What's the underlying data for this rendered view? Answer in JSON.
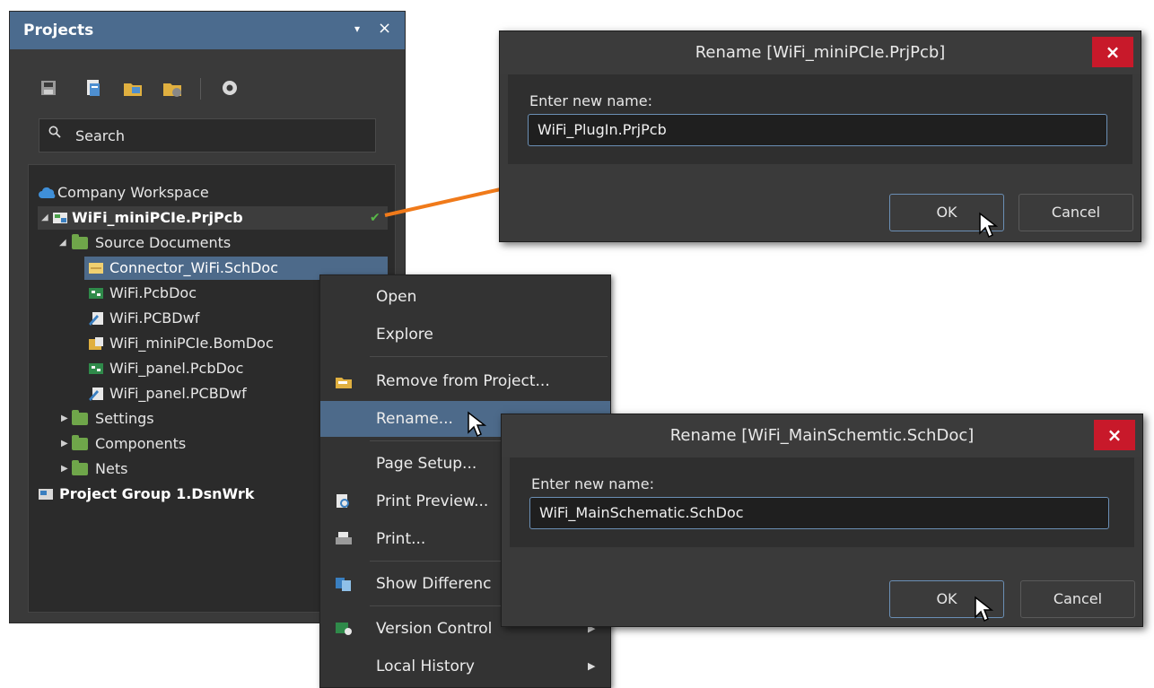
{
  "projects_panel": {
    "title": "Projects",
    "pin_icon": "▾",
    "close_icon": "×",
    "toolbar_icons": [
      "save-icon",
      "project-options-icon",
      "add-folder-icon",
      "remove-folder-icon",
      "settings-icon"
    ],
    "search": {
      "placeholder": "Search"
    },
    "tree": [
      {
        "label": "Company Workspace",
        "icon": "cloud-icon"
      },
      {
        "label": "WiFi_miniPCIe.PrjPcb",
        "icon": "pcb-project-icon",
        "status": "✔"
      },
      {
        "label": "Source Documents",
        "icon": "folder-icon"
      },
      {
        "label": "Connector_WiFi.SchDoc",
        "icon": "schematic-doc-icon"
      },
      {
        "label": "WiFi.PcbDoc",
        "icon": "pcb-doc-icon"
      },
      {
        "label": "WiFi.PCBDwf",
        "icon": "pcb-draftsman-icon"
      },
      {
        "label": "WiFi_miniPCIe.BomDoc",
        "icon": "bom-doc-icon"
      },
      {
        "label": "WiFi_panel.PcbDoc",
        "icon": "pcb-doc-icon"
      },
      {
        "label": "WiFi_panel.PCBDwf",
        "icon": "pcb-draftsman-icon"
      },
      {
        "label": "Settings",
        "icon": "folder-icon"
      },
      {
        "label": "Components",
        "icon": "folder-icon"
      },
      {
        "label": "Nets",
        "icon": "folder-icon"
      },
      {
        "label": "Project Group 1.DsnWrk",
        "icon": "project-group-icon"
      }
    ]
  },
  "context_menu": {
    "items": [
      {
        "label": "Open"
      },
      {
        "label": "Explore"
      },
      {
        "label": "Remove from Project..."
      },
      {
        "label": "Rename..."
      },
      {
        "label": "Page Setup..."
      },
      {
        "label": "Print Preview..."
      },
      {
        "label": "Print..."
      },
      {
        "label": "Show Differenc"
      },
      {
        "label": "Version Control"
      },
      {
        "label": "Local History"
      }
    ]
  },
  "dialog_project": {
    "title": "Rename [WiFi_miniPCIe.PrjPcb]",
    "prompt": "Enter new name:",
    "value": "WiFi_PlugIn.PrjPcb",
    "ok": "OK",
    "cancel": "Cancel",
    "close_icon": "×"
  },
  "dialog_doc": {
    "title": "Rename [WiFi_MainSchemtic.SchDoc]",
    "prompt": "Enter new name:",
    "value": "WiFi_MainSchematic.SchDoc",
    "ok": "OK",
    "cancel": "Cancel",
    "close_icon": "×"
  },
  "colors": {
    "panel_title": "#4b6b8e",
    "menu_highlight": "#4d6a8a",
    "close_red": "#c8192a",
    "arrow_orange": "#f07a1a",
    "folder_green": "#6fa64a"
  }
}
